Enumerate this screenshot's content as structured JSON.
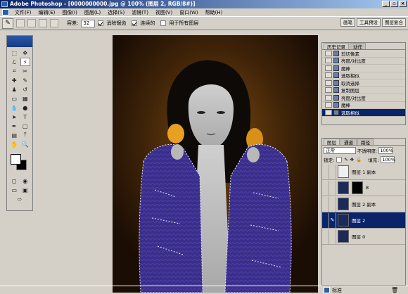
{
  "window": {
    "title": "Adobe Photoshop - [0000000000.jpg @ 100% (图层 2, RGB/8#)]"
  },
  "menu": [
    "文件(F)",
    "编辑(E)",
    "图像(I)",
    "图层(L)",
    "选择(S)",
    "滤镜(T)",
    "视图(V)",
    "窗口(W)",
    "帮助(H)"
  ],
  "options": {
    "tolerance_label": "容差:",
    "tolerance_value": "32",
    "antialias_label": "消除锯齿",
    "contiguous_label": "连续的",
    "all_layers_label": "用于所有图层"
  },
  "palette_well": [
    "画笔",
    "工具预设",
    "图层复合"
  ],
  "history_panel": {
    "tabs": [
      "历史记录",
      "动作"
    ],
    "items": [
      {
        "label": "剪切像素"
      },
      {
        "label": "亮度/对比度"
      },
      {
        "label": "魔棒"
      },
      {
        "label": "选取相似"
      },
      {
        "label": "取消选择"
      },
      {
        "label": "复制图层"
      },
      {
        "label": "亮度/对比度"
      },
      {
        "label": "魔棒"
      },
      {
        "label": "选取相似",
        "selected": true
      }
    ]
  },
  "layers_panel": {
    "tabs": [
      "图层",
      "通道",
      "路径"
    ],
    "blend_mode": "正常",
    "opacity_label": "不透明度:",
    "opacity_value": "100%",
    "lock_label": "锁定:",
    "fill_label": "填充:",
    "fill_value": "100%",
    "layers": [
      {
        "name": "图层 1 副本"
      },
      {
        "name": "8",
        "has_mask": true
      },
      {
        "name": "图层 2 副本"
      },
      {
        "name": "图层 2",
        "selected": true
      },
      {
        "name": "图层 0"
      }
    ]
  },
  "status": {
    "label": "标准"
  },
  "colors": {
    "title_start": "#0a246a",
    "title_end": "#a6caf0",
    "chrome": "#d4d0c8",
    "jacket": "#3a2e8a",
    "selection": "#0a246a"
  }
}
